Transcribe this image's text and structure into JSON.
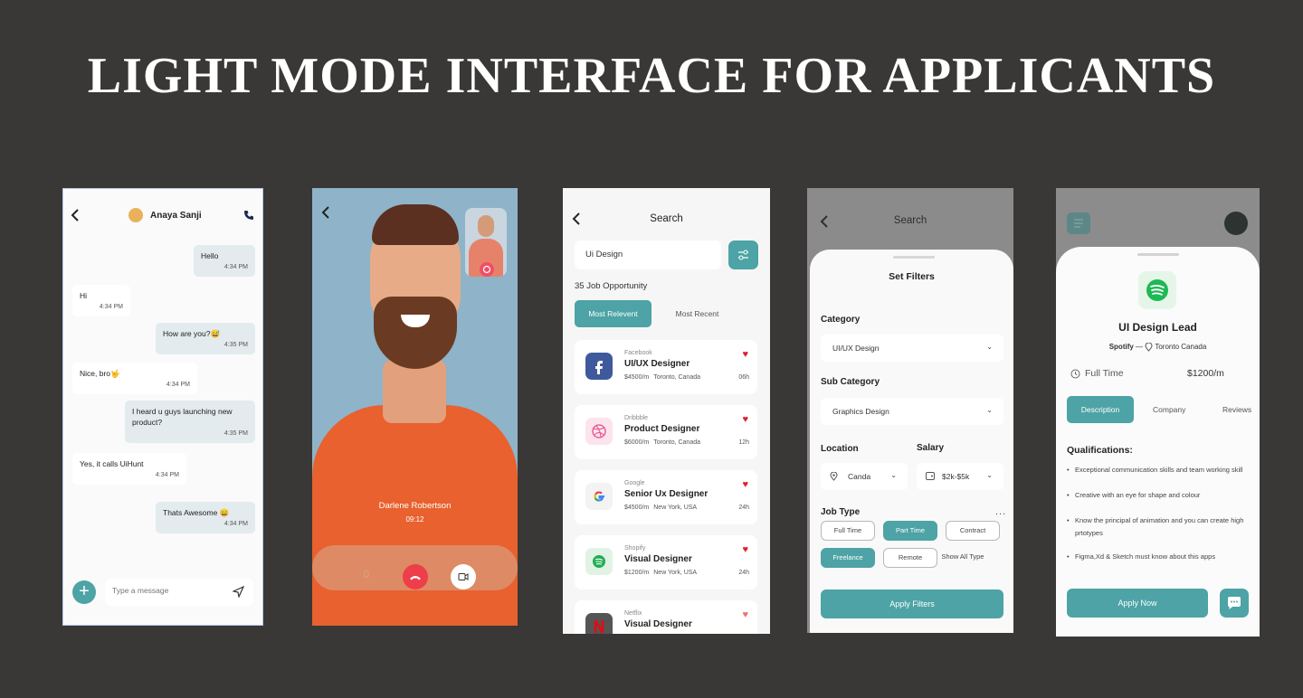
{
  "colors": {
    "accent": "#4da3a5",
    "heart": "#e0202f",
    "end_call": "#ee3e4a",
    "background": "#393836"
  },
  "headline": "LIGHT MODE INTERFACE FOR APPLICANTS",
  "chat": {
    "contact_name": "Anaya Sanji",
    "icons": {
      "back": "chevron-left-icon",
      "call": "phone-icon",
      "add": "plus-icon",
      "send": "send-icon"
    },
    "messages": [
      {
        "text": "Hello",
        "time": "4:34 PM",
        "direction": "out"
      },
      {
        "text": "Hi",
        "time": "4:34 PM",
        "direction": "in"
      },
      {
        "text": "How are you?😅",
        "time": "4:35 PM",
        "direction": "out"
      },
      {
        "text": "Nice, bro🤟",
        "time": "4:34 PM",
        "direction": "in"
      },
      {
        "text": "I heard u guys launching new product?",
        "time": "4:35 PM",
        "direction": "out"
      },
      {
        "text": "Yes, it calls UiHunt",
        "time": "4:34 PM",
        "direction": "in"
      },
      {
        "text": "Thats Awesome 😄",
        "time": "4:34 PM",
        "direction": "out"
      }
    ],
    "input_placeholder": "Type a message"
  },
  "video_call": {
    "caller_name": "Darlene Robertson",
    "duration": "09:12",
    "icons": {
      "back": "chevron-left-icon",
      "mic": "mic-icon",
      "end": "end-call-icon",
      "camera": "video-camera-icon",
      "switch": "switch-camera-icon"
    }
  },
  "search": {
    "title": "Search",
    "query": "Ui Design",
    "result_count": "35 Job Opportunity",
    "tabs": [
      "Most Relevent",
      "Most Recent"
    ],
    "jobs": [
      {
        "company": "Facebook",
        "title": "UI/UX Designer",
        "salary": "$4500/m",
        "location": "Toronto, Canada",
        "age": "06h",
        "logo": "facebook-icon"
      },
      {
        "company": "Dribbble",
        "title": "Product Designer",
        "salary": "$6000/m",
        "location": "Toronto, Canada",
        "age": "12h",
        "logo": "dribbble-icon"
      },
      {
        "company": "Google",
        "title": "Senior Ux Designer",
        "salary": "$4500/m",
        "location": "New York, USA",
        "age": "24h",
        "logo": "google-icon"
      },
      {
        "company": "Shopify",
        "title": "Visual Designer",
        "salary": "$1200/m",
        "location": "New York, USA",
        "age": "24h",
        "logo": "shopify-icon"
      },
      {
        "company": "Netflix",
        "title": "Visual Designer",
        "salary": "",
        "location": "",
        "age": "",
        "logo": "netflix-icon"
      }
    ]
  },
  "filters": {
    "bg_title": "Search",
    "sheet_title": "Set Filters",
    "category_label": "Category",
    "category_value": "UI/UX Design",
    "subcategory_label": "Sub Category",
    "subcategory_value": "Graphics Design",
    "location_label": "Location",
    "location_value": "Canda",
    "salary_label": "Salary",
    "salary_value": "$2k-$5k",
    "job_type_label": "Job Type",
    "job_types": [
      {
        "label": "Full Time",
        "selected": false
      },
      {
        "label": "Part Time",
        "selected": true
      },
      {
        "label": "Contract",
        "selected": false
      },
      {
        "label": "Freelance",
        "selected": true
      },
      {
        "label": "Remote",
        "selected": false
      }
    ],
    "show_all": "Show All Type",
    "more": "...",
    "apply_label": "Apply Filters"
  },
  "job_detail": {
    "title": "UI Design Lead",
    "company": "Spotify",
    "separator": "—",
    "location": "Toronto Canada",
    "job_type": "Full Time",
    "salary": "$1200/m",
    "tabs": [
      "Description",
      "Company",
      "Reviews"
    ],
    "qualifications_title": "Qualifications:",
    "qualifications": [
      "Exceptional communication skills and team working skill",
      "Creative with an eye for shape and colour",
      "Know the principal of animation and you can create high prtotypes",
      "Figma,Xd & Sketch must know about this apps"
    ],
    "apply_label": "Apply Now",
    "logo": "spotify-icon"
  }
}
